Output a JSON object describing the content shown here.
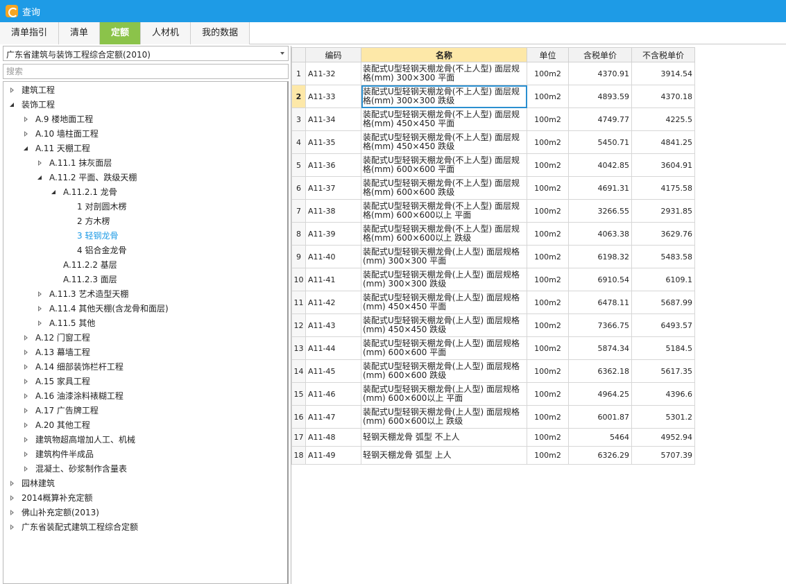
{
  "window": {
    "title": "查询"
  },
  "tabs": [
    {
      "label": "清单指引",
      "active": false
    },
    {
      "label": "清单",
      "active": false
    },
    {
      "label": "定额",
      "active": true
    },
    {
      "label": "人材机",
      "active": false
    },
    {
      "label": "我的数据",
      "active": false
    }
  ],
  "left": {
    "library_select": "广东省建筑与装饰工程综合定额(2010)",
    "search_placeholder": "搜索",
    "tree": [
      {
        "label": "建筑工程",
        "level": 0,
        "toggle": "collapsed"
      },
      {
        "label": "装饰工程",
        "level": 0,
        "toggle": "expanded"
      },
      {
        "label": "A.9 楼地面工程",
        "level": 1,
        "toggle": "collapsed"
      },
      {
        "label": "A.10 墙柱面工程",
        "level": 1,
        "toggle": "collapsed"
      },
      {
        "label": "A.11 天棚工程",
        "level": 1,
        "toggle": "expanded"
      },
      {
        "label": "A.11.1 抹灰面层",
        "level": 2,
        "toggle": "collapsed"
      },
      {
        "label": "A.11.2 平面、跌级天棚",
        "level": 2,
        "toggle": "expanded"
      },
      {
        "label": "A.11.2.1 龙骨",
        "level": 3,
        "toggle": "expanded"
      },
      {
        "label": "1 对剖圆木楞",
        "level": 4,
        "toggle": "none"
      },
      {
        "label": "2 方木楞",
        "level": 4,
        "toggle": "none"
      },
      {
        "label": "3 轻钢龙骨",
        "level": 4,
        "toggle": "none",
        "selected": true
      },
      {
        "label": "4 铝合金龙骨",
        "level": 4,
        "toggle": "none"
      },
      {
        "label": "A.11.2.2 基层",
        "level": 3,
        "toggle": "none"
      },
      {
        "label": "A.11.2.3 面层",
        "level": 3,
        "toggle": "none"
      },
      {
        "label": "A.11.3 艺术造型天棚",
        "level": 2,
        "toggle": "collapsed"
      },
      {
        "label": "A.11.4 其他天棚(含龙骨和面层)",
        "level": 2,
        "toggle": "collapsed"
      },
      {
        "label": "A.11.5 其他",
        "level": 2,
        "toggle": "collapsed"
      },
      {
        "label": "A.12 门窗工程",
        "level": 1,
        "toggle": "collapsed"
      },
      {
        "label": "A.13 幕墙工程",
        "level": 1,
        "toggle": "collapsed"
      },
      {
        "label": "A.14 细部装饰栏杆工程",
        "level": 1,
        "toggle": "collapsed"
      },
      {
        "label": "A.15 家具工程",
        "level": 1,
        "toggle": "collapsed"
      },
      {
        "label": "A.16 油漆涂料裱糊工程",
        "level": 1,
        "toggle": "collapsed"
      },
      {
        "label": "A.17 广告牌工程",
        "level": 1,
        "toggle": "collapsed"
      },
      {
        "label": "A.20 其他工程",
        "level": 1,
        "toggle": "collapsed"
      },
      {
        "label": "建筑物超高增加人工、机械",
        "level": 1,
        "toggle": "collapsed"
      },
      {
        "label": "建筑构件半成品",
        "level": 1,
        "toggle": "collapsed"
      },
      {
        "label": "混凝土、砂浆制作含量表",
        "level": 1,
        "toggle": "collapsed"
      },
      {
        "label": "园林建筑",
        "level": 0,
        "toggle": "collapsed"
      },
      {
        "label": "2014概算补充定额",
        "level": 0,
        "toggle": "collapsed"
      },
      {
        "label": "佛山补充定额(2013)",
        "level": 0,
        "toggle": "collapsed"
      },
      {
        "label": "广东省装配式建筑工程综合定额",
        "level": 0,
        "toggle": "collapsed"
      }
    ]
  },
  "grid": {
    "columns": [
      "",
      "编码",
      "名称",
      "单位",
      "含税单价",
      "不含税单价"
    ],
    "current_row": 2,
    "rows": [
      {
        "no": "1",
        "code": "A11-32",
        "name": "装配式U型轻钢天棚龙骨(不上人型) 面层规格(mm) 300×300 平面",
        "unit": "100m2",
        "price_tax": "4370.91",
        "price_notax": "3914.54"
      },
      {
        "no": "2",
        "code": "A11-33",
        "name": "装配式U型轻钢天棚龙骨(不上人型) 面层规格(mm) 300×300 跌级",
        "unit": "100m2",
        "price_tax": "4893.59",
        "price_notax": "4370.18"
      },
      {
        "no": "3",
        "code": "A11-34",
        "name": "装配式U型轻钢天棚龙骨(不上人型) 面层规格(mm) 450×450 平面",
        "unit": "100m2",
        "price_tax": "4749.77",
        "price_notax": "4225.5"
      },
      {
        "no": "4",
        "code": "A11-35",
        "name": "装配式U型轻钢天棚龙骨(不上人型) 面层规格(mm) 450×450 跌级",
        "unit": "100m2",
        "price_tax": "5450.71",
        "price_notax": "4841.25"
      },
      {
        "no": "5",
        "code": "A11-36",
        "name": "装配式U型轻钢天棚龙骨(不上人型) 面层规格(mm) 600×600 平面",
        "unit": "100m2",
        "price_tax": "4042.85",
        "price_notax": "3604.91"
      },
      {
        "no": "6",
        "code": "A11-37",
        "name": "装配式U型轻钢天棚龙骨(不上人型) 面层规格(mm) 600×600 跌级",
        "unit": "100m2",
        "price_tax": "4691.31",
        "price_notax": "4175.58"
      },
      {
        "no": "7",
        "code": "A11-38",
        "name": "装配式U型轻钢天棚龙骨(不上人型) 面层规格(mm) 600×600以上 平面",
        "unit": "100m2",
        "price_tax": "3266.55",
        "price_notax": "2931.85"
      },
      {
        "no": "8",
        "code": "A11-39",
        "name": "装配式U型轻钢天棚龙骨(不上人型) 面层规格(mm) 600×600以上 跌级",
        "unit": "100m2",
        "price_tax": "4063.38",
        "price_notax": "3629.76"
      },
      {
        "no": "9",
        "code": "A11-40",
        "name": "装配式U型轻钢天棚龙骨(上人型) 面层规格(mm) 300×300 平面",
        "unit": "100m2",
        "price_tax": "6198.32",
        "price_notax": "5483.58"
      },
      {
        "no": "10",
        "code": "A11-41",
        "name": "装配式U型轻钢天棚龙骨(上人型) 面层规格(mm) 300×300 跌级",
        "unit": "100m2",
        "price_tax": "6910.54",
        "price_notax": "6109.1"
      },
      {
        "no": "11",
        "code": "A11-42",
        "name": "装配式U型轻钢天棚龙骨(上人型) 面层规格(mm) 450×450 平面",
        "unit": "100m2",
        "price_tax": "6478.11",
        "price_notax": "5687.99"
      },
      {
        "no": "12",
        "code": "A11-43",
        "name": "装配式U型轻钢天棚龙骨(上人型) 面层规格(mm) 450×450 跌级",
        "unit": "100m2",
        "price_tax": "7366.75",
        "price_notax": "6493.57"
      },
      {
        "no": "13",
        "code": "A11-44",
        "name": "装配式U型轻钢天棚龙骨(上人型) 面层规格(mm) 600×600 平面",
        "unit": "100m2",
        "price_tax": "5874.34",
        "price_notax": "5184.5"
      },
      {
        "no": "14",
        "code": "A11-45",
        "name": "装配式U型轻钢天棚龙骨(上人型) 面层规格(mm) 600×600 跌级",
        "unit": "100m2",
        "price_tax": "6362.18",
        "price_notax": "5617.35"
      },
      {
        "no": "15",
        "code": "A11-46",
        "name": "装配式U型轻钢天棚龙骨(上人型) 面层规格(mm) 600×600以上 平面",
        "unit": "100m2",
        "price_tax": "4964.25",
        "price_notax": "4396.6"
      },
      {
        "no": "16",
        "code": "A11-47",
        "name": "装配式U型轻钢天棚龙骨(上人型) 面层规格(mm) 600×600以上 跌级",
        "unit": "100m2",
        "price_tax": "6001.87",
        "price_notax": "5301.2"
      },
      {
        "no": "17",
        "code": "A11-48",
        "name": "轻钢天棚龙骨 弧型 不上人",
        "unit": "100m2",
        "price_tax": "5464",
        "price_notax": "4952.94"
      },
      {
        "no": "18",
        "code": "A11-49",
        "name": "轻钢天棚龙骨 弧型 上人",
        "unit": "100m2",
        "price_tax": "6326.29",
        "price_notax": "5707.39"
      }
    ]
  }
}
